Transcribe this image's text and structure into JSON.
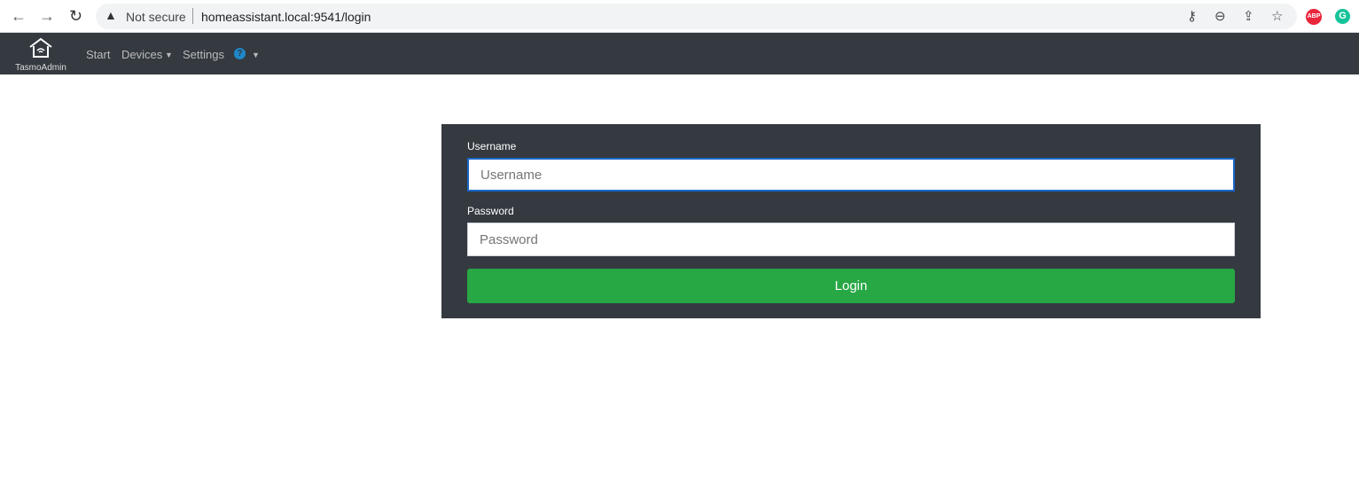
{
  "browser": {
    "security": "Not secure",
    "url": "homeassistant.local:9541/login",
    "ext_abp": "ABP",
    "ext_g": "G"
  },
  "nav": {
    "brand": "TasmoAdmin",
    "items": [
      {
        "label": "Start"
      },
      {
        "label": "Devices"
      },
      {
        "label": "Settings"
      }
    ],
    "help": "?"
  },
  "form": {
    "username_label": "Username",
    "username_placeholder": "Username",
    "password_label": "Password",
    "password_placeholder": "Password",
    "login": "Login"
  },
  "colors": {
    "nav": "#343a40",
    "login": "#28a745",
    "focus": "#1a66c8"
  }
}
